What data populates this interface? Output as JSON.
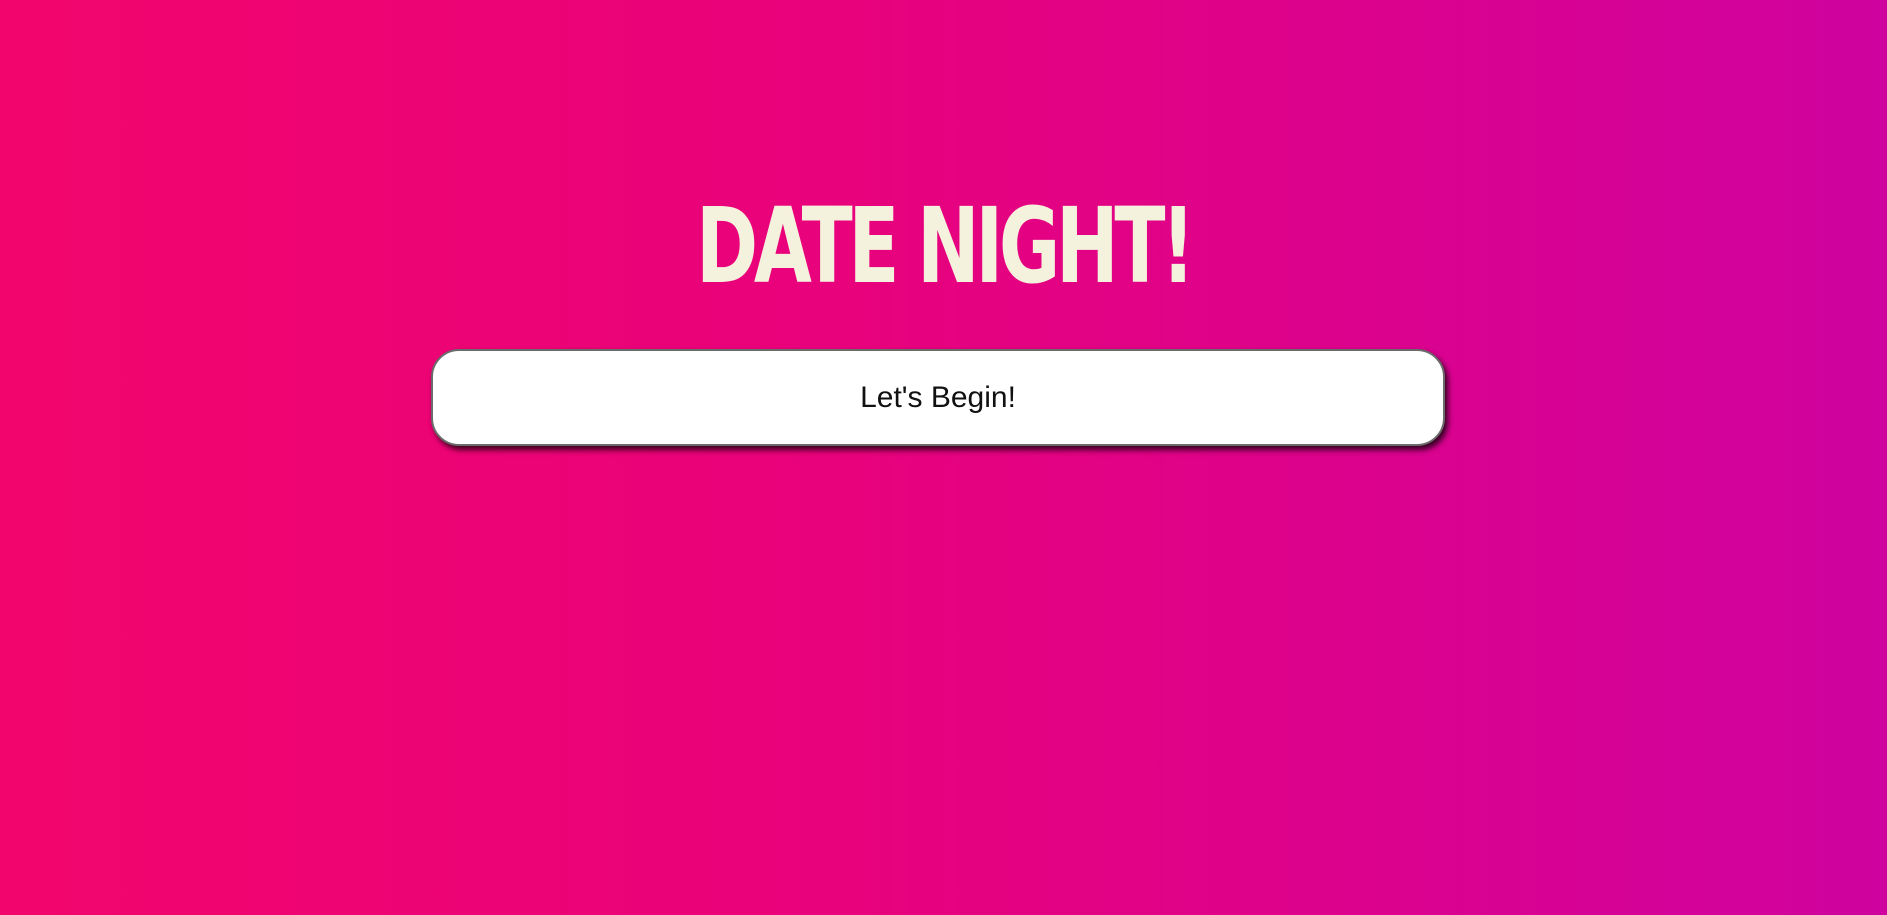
{
  "page": {
    "title": "DATE NIGHT!",
    "begin_button_label": "Let's Begin!"
  },
  "colors": {
    "background_start": "#f2056c",
    "background_end": "#cf029f",
    "title_text": "#f4f2dc",
    "button_background": "#ffffff",
    "button_text": "#111111"
  }
}
